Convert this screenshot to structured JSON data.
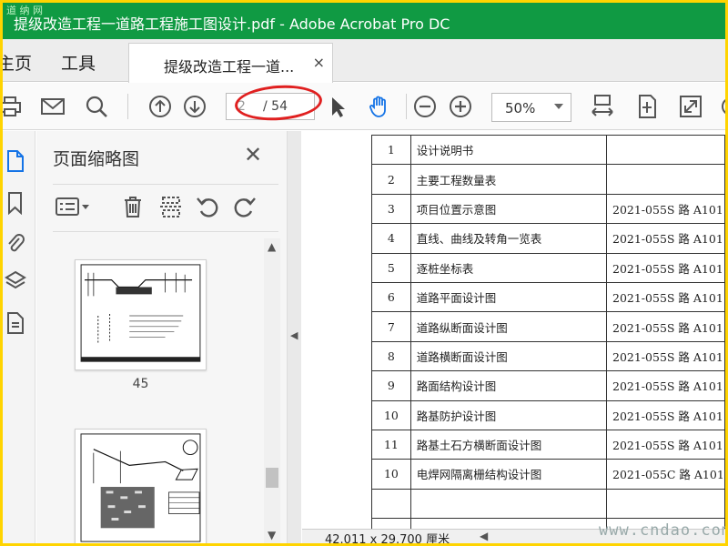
{
  "window": {
    "title": "提级改造工程一道路工程施工图设计.pdf - Adobe Acrobat Pro DC",
    "logo_text": "道 纳 网"
  },
  "tabs": {
    "home": "主页",
    "tools": "工具",
    "document": "提级改造工程一道...",
    "close": "×"
  },
  "toolbar": {
    "current_page": "2",
    "total_pages": "/ 54",
    "zoom": "50%",
    "icons": [
      "print-icon",
      "mail-icon",
      "search-icon",
      "page-up-icon",
      "page-down-icon",
      "select-cursor-icon",
      "hand-tool-icon",
      "zoom-out-icon",
      "zoom-in-icon",
      "fit-width-icon",
      "fit-page-icon",
      "fullscreen-icon"
    ]
  },
  "panel": {
    "title": "页面缩略图",
    "close": "✕",
    "thumbnails": [
      {
        "page": "45"
      },
      {
        "page": ""
      }
    ]
  },
  "sheet": {
    "rows": [
      {
        "no": "1",
        "name": "设计说明书",
        "code": ""
      },
      {
        "no": "2",
        "name": "主要工程数量表",
        "code": ""
      },
      {
        "no": "3",
        "name": "项目位置示意图",
        "code": "2021-055S 路 A101"
      },
      {
        "no": "4",
        "name": "直线、曲线及转角一览表",
        "code": "2021-055S 路 A101"
      },
      {
        "no": "5",
        "name": "逐桩坐标表",
        "code": "2021-055S 路 A101"
      },
      {
        "no": "6",
        "name": "道路平面设计图",
        "code": "2021-055S 路 A101"
      },
      {
        "no": "7",
        "name": "道路纵断面设计图",
        "code": "2021-055S 路 A101"
      },
      {
        "no": "8",
        "name": "道路横断面设计图",
        "code": "2021-055S 路 A101"
      },
      {
        "no": "9",
        "name": "路面结构设计图",
        "code": "2021-055S 路 A101"
      },
      {
        "no": "10",
        "name": "路基防护设计图",
        "code": "2021-055S 路 A101"
      },
      {
        "no": "11",
        "name": "路基土石方横断面设计图",
        "code": "2021-055S 路 A101"
      },
      {
        "no": "10",
        "name": "电焊网隔离栅结构设计图",
        "code": "2021-055C 路 A101"
      },
      {
        "no": "",
        "name": "",
        "code": ""
      },
      {
        "no": "",
        "name": "",
        "code": ""
      }
    ]
  },
  "status": {
    "dimensions": "42.011 x 29.700 厘米"
  },
  "watermark": "www.cndao.com",
  "colors": {
    "titlebar": "#109a43",
    "frame": "#ffd400",
    "hand_tool": "#1473e6",
    "annotation": "#e02020"
  }
}
